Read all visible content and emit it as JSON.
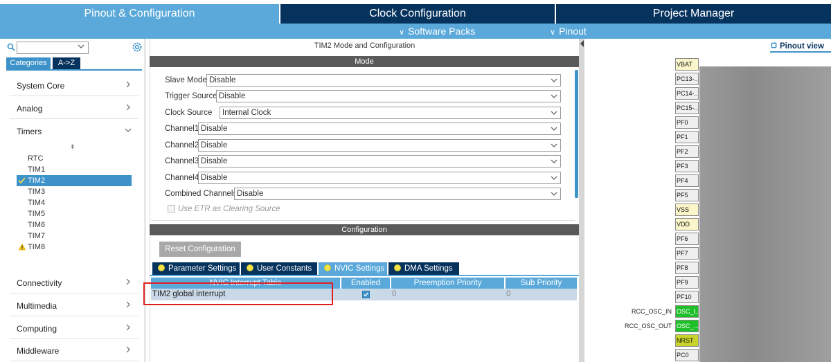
{
  "top_tabs": {
    "pinout": "Pinout & Configuration",
    "clock": "Clock Configuration",
    "project": "Project Manager"
  },
  "sub_menu": {
    "software_packs": "Software Packs",
    "pinout": "Pinout"
  },
  "sidebar": {
    "tabs": {
      "categories": "Categories",
      "az": "A->Z"
    },
    "categories": [
      "System Core",
      "Analog",
      "Timers",
      "Connectivity",
      "Multimedia",
      "Computing",
      "Middleware"
    ],
    "timers": [
      "RTC",
      "TIM1",
      "TIM2",
      "TIM3",
      "TIM4",
      "TIM5",
      "TIM6",
      "TIM7",
      "TIM8"
    ],
    "selected_timer": "TIM2",
    "warning_timer": "TIM8"
  },
  "panel": {
    "title": "TIM2 Mode and Configuration",
    "mode_header": "Mode",
    "config_header": "Configuration",
    "mode_rows": [
      {
        "label": "Slave Mode",
        "value": "Disable"
      },
      {
        "label": "Trigger Source",
        "value": "Disable"
      },
      {
        "label": "Clock Source",
        "value": "Internal Clock"
      },
      {
        "label": "Channel1",
        "value": "Disable"
      },
      {
        "label": "Channel2",
        "value": "Disable"
      },
      {
        "label": "Channel3",
        "value": "Disable"
      },
      {
        "label": "Channel4",
        "value": "Disable"
      },
      {
        "label": "Combined Channels",
        "value": "Disable"
      }
    ],
    "etr_label": "Use ETR as Clearing Source",
    "reset_button": "Reset Configuration",
    "config_tabs": [
      "Parameter Settings",
      "User Constants",
      "NVIC Settings",
      "DMA Settings"
    ],
    "active_config_tab": "NVIC Settings",
    "nvic_table": {
      "headers": [
        "NVIC Interrupt Table",
        "Enabled",
        "Preemption Priority",
        "Sub Priority"
      ],
      "rows": [
        {
          "name": "TIM2 global interrupt",
          "enabled": true,
          "preemption": "0",
          "sub": "0"
        }
      ]
    }
  },
  "pinout_view": {
    "label": "Pinout view",
    "pins": [
      {
        "name": "VBAT",
        "style": "yellow"
      },
      {
        "name": "PC13-...",
        "style": "gray"
      },
      {
        "name": "PC14-...",
        "style": "gray"
      },
      {
        "name": "PC15-...",
        "style": "gray"
      },
      {
        "name": "PF0",
        "style": "gray"
      },
      {
        "name": "PF1",
        "style": "gray"
      },
      {
        "name": "PF2",
        "style": "gray"
      },
      {
        "name": "PF3",
        "style": "gray"
      },
      {
        "name": "PF4",
        "style": "gray"
      },
      {
        "name": "PF5",
        "style": "gray"
      },
      {
        "name": "VSS",
        "style": "yellow"
      },
      {
        "name": "VDD",
        "style": "yellow"
      },
      {
        "name": "PF6",
        "style": "gray"
      },
      {
        "name": "PF7",
        "style": "gray"
      },
      {
        "name": "PF8",
        "style": "gray"
      },
      {
        "name": "PF9",
        "style": "gray"
      },
      {
        "name": "PF10",
        "style": "gray"
      },
      {
        "name": "OSC_I...",
        "style": "green",
        "external": "RCC_OSC_IN"
      },
      {
        "name": "OSC_...",
        "style": "green",
        "external": "RCC_OSC_OUT"
      },
      {
        "name": "NRST",
        "style": "lime"
      },
      {
        "name": "PC0",
        "style": "gray"
      }
    ]
  },
  "colors": {
    "tab_active": "#5aa9da",
    "tab_inactive": "#06335e",
    "highlight": "#3d92c9",
    "annotation": "#e02020"
  }
}
